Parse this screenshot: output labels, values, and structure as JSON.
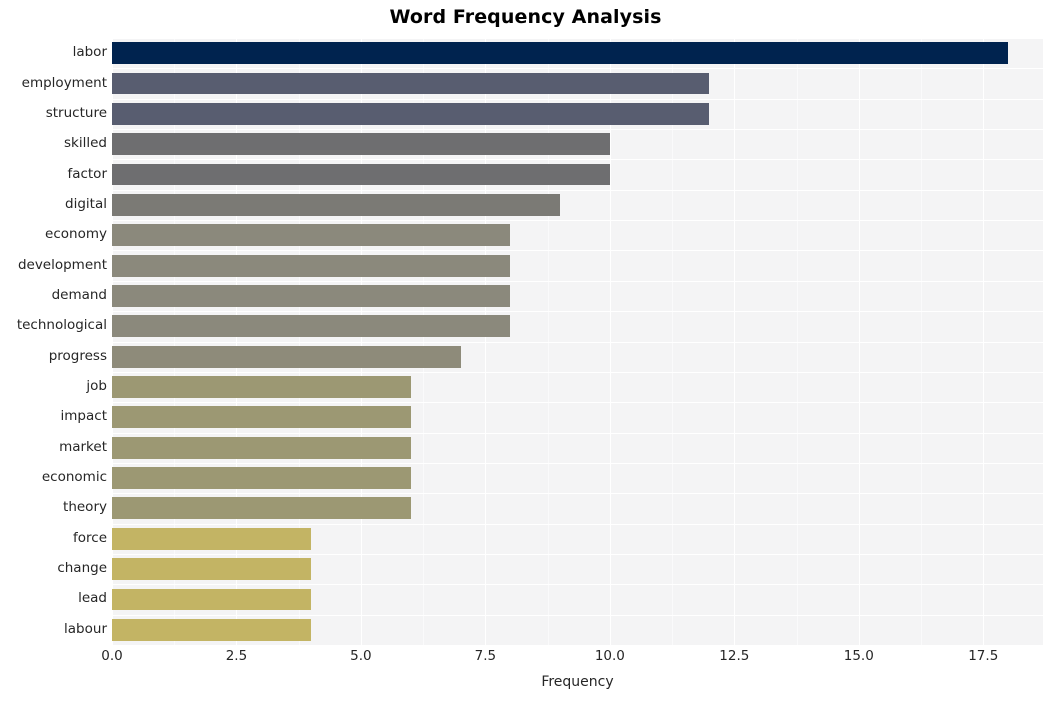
{
  "chart_data": {
    "type": "bar",
    "orientation": "horizontal",
    "title": "Word Frequency Analysis",
    "xlabel": "Frequency",
    "ylabel": "",
    "categories": [
      "labor",
      "employment",
      "structure",
      "skilled",
      "factor",
      "digital",
      "economy",
      "development",
      "demand",
      "technological",
      "progress",
      "job",
      "impact",
      "market",
      "economic",
      "theory",
      "force",
      "change",
      "lead",
      "labour"
    ],
    "values": [
      18,
      12,
      12,
      10,
      10,
      9,
      8,
      8,
      8,
      8,
      7,
      6,
      6,
      6,
      6,
      6,
      4,
      4,
      4,
      4
    ],
    "bar_colors": [
      "#00234f",
      "#585d70",
      "#585d70",
      "#6e6e70",
      "#6e6e70",
      "#7b7a75",
      "#8b897c",
      "#8b897c",
      "#8b897c",
      "#8b897c",
      "#8e8b7a",
      "#9c9873",
      "#9c9873",
      "#9c9873",
      "#9c9873",
      "#9c9873",
      "#c3b464",
      "#c3b464",
      "#c3b464",
      "#c3b464"
    ],
    "xlim": [
      0,
      18.7
    ],
    "xticks": [
      0,
      2.5,
      5,
      7.5,
      10,
      12.5,
      15,
      17.5
    ],
    "xtick_labels": [
      "0.0",
      "2.5",
      "5.0",
      "7.5",
      "10.0",
      "12.5",
      "15.0",
      "17.5"
    ],
    "grid": true,
    "legend": "none",
    "plot_background": "#f4f4f5",
    "grid_color": "#ffffff",
    "figure_background": "#ffffff",
    "text_color": "#262626"
  }
}
